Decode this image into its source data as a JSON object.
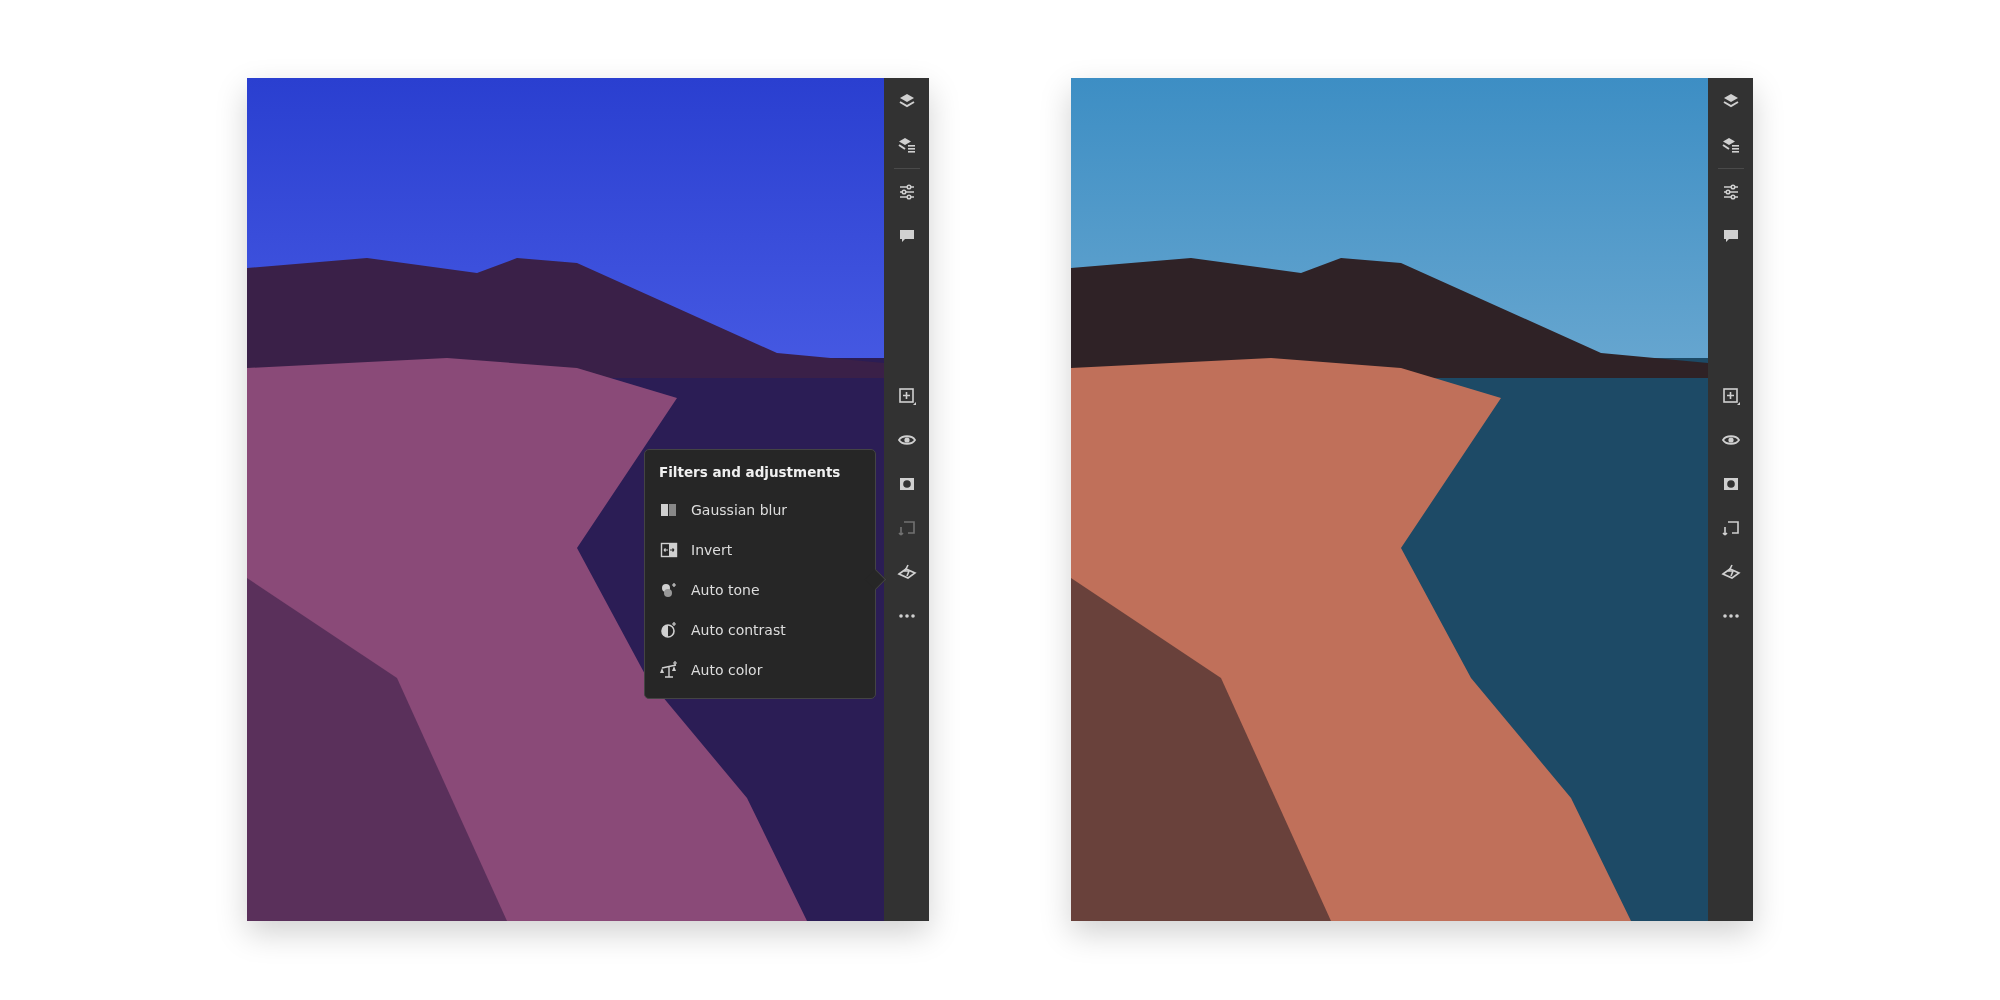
{
  "panels": [
    {
      "photo": {
        "kind": "blue-tint"
      },
      "toolbar": {
        "top": [
          {
            "kind": "layers",
            "disabled": false
          },
          {
            "kind": "layer-properties",
            "disabled": false
          },
          {
            "kind": "adjustments",
            "disabled": false
          },
          {
            "kind": "comments",
            "disabled": false
          }
        ],
        "bottom": [
          {
            "kind": "add",
            "disabled": false
          },
          {
            "kind": "visibility",
            "disabled": false
          },
          {
            "kind": "mask",
            "disabled": false
          },
          {
            "kind": "replace",
            "disabled": true
          },
          {
            "kind": "filters",
            "disabled": false
          },
          {
            "kind": "more",
            "disabled": false
          }
        ]
      },
      "menu": {
        "title": "Filters and adjustments",
        "items": [
          {
            "kind": "blur",
            "label": "Gaussian blur"
          },
          {
            "kind": "invert",
            "label": "Invert"
          },
          {
            "kind": "tone",
            "label": "Auto tone"
          },
          {
            "kind": "contrast",
            "label": "Auto contrast"
          },
          {
            "kind": "color",
            "label": "Auto color"
          }
        ]
      }
    },
    {
      "photo": {
        "kind": "natural"
      },
      "toolbar": {
        "top": [
          {
            "kind": "layers",
            "disabled": false
          },
          {
            "kind": "layer-properties",
            "disabled": false
          },
          {
            "kind": "adjustments",
            "disabled": false
          },
          {
            "kind": "comments",
            "disabled": false
          }
        ],
        "bottom": [
          {
            "kind": "add",
            "disabled": false
          },
          {
            "kind": "visibility",
            "disabled": false
          },
          {
            "kind": "mask",
            "disabled": false
          },
          {
            "kind": "replace",
            "disabled": false
          },
          {
            "kind": "filters",
            "disabled": false
          },
          {
            "kind": "more",
            "disabled": false
          }
        ]
      }
    }
  ]
}
